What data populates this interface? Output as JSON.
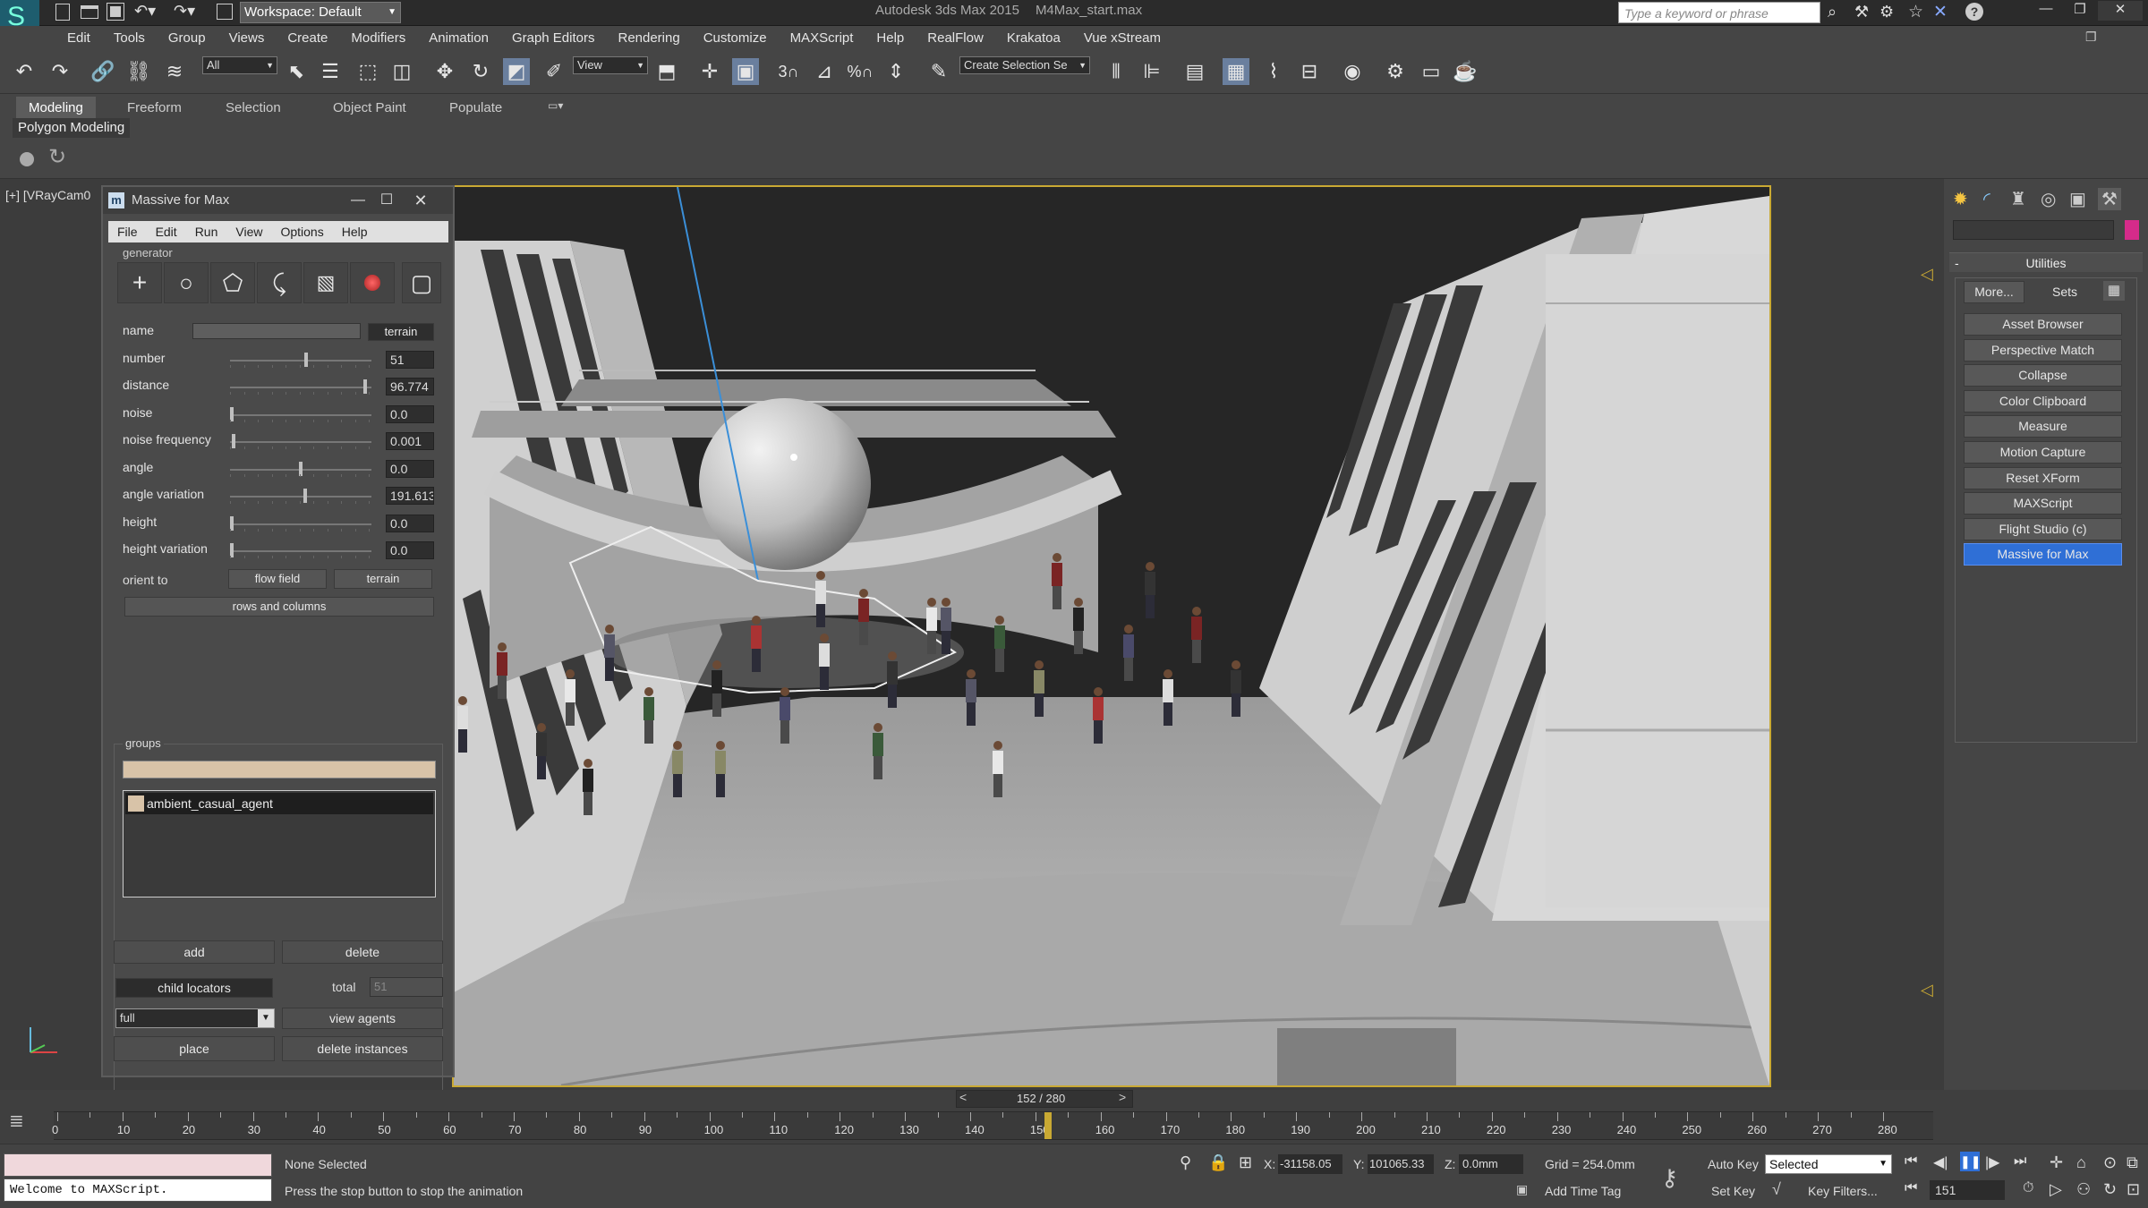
{
  "app": {
    "title": "Autodesk 3ds Max 2015",
    "file": "M4Max_start.max",
    "workspace": "Workspace: Default",
    "search_placeholder": "Type a keyword or phrase"
  },
  "menus": [
    "Edit",
    "Tools",
    "Group",
    "Views",
    "Create",
    "Modifiers",
    "Animation",
    "Graph Editors",
    "Rendering",
    "Customize",
    "MAXScript",
    "Help",
    "RealFlow",
    "Krakatoa",
    "Vue xStream"
  ],
  "toolbar": {
    "filter": "All",
    "ref_coord": "View",
    "selection_set": "Create Selection Se",
    "snap_label": "3"
  },
  "ribbon": {
    "tabs": [
      "Modeling",
      "Freeform",
      "Selection",
      "Object Paint",
      "Populate"
    ],
    "sub": "Polygon Modeling"
  },
  "viewport": {
    "label": "[+] [VRayCam0"
  },
  "massive": {
    "title": "Massive for Max",
    "menus": [
      "File",
      "Edit",
      "Run",
      "View",
      "Options",
      "Help"
    ],
    "generator_label": "generator",
    "params": [
      {
        "label": "name",
        "value": "",
        "level": null
      },
      {
        "label": "number",
        "value": "51",
        "level": 0.54
      },
      {
        "label": "distance",
        "value": "96.774",
        "level": 0.97
      },
      {
        "label": "noise",
        "value": "0.0",
        "level": 0.0
      },
      {
        "label": "noise frequency",
        "value": "0.001",
        "level": 0.01
      },
      {
        "label": "angle",
        "value": "0.0",
        "level": 0.5
      },
      {
        "label": "angle variation",
        "value": "191.613",
        "level": 0.53
      },
      {
        "label": "height",
        "value": "0.0",
        "level": 0.0
      },
      {
        "label": "height variation",
        "value": "0.0",
        "level": 0.0
      }
    ],
    "name_button": "terrain",
    "orient_label": "orient to",
    "orient_options": [
      "flow field",
      "terrain"
    ],
    "rows_columns": "rows and columns",
    "groups_label": "groups",
    "group_items": [
      "ambient_casual_agent"
    ],
    "add": "add",
    "delete": "delete",
    "child_locators": "child locators",
    "total_label": "total",
    "total_value": "51",
    "mode": "full",
    "view_agents": "view agents",
    "place": "place",
    "delete_instances": "delete instances"
  },
  "command_panel": {
    "section": "Utilities",
    "more": "More...",
    "sets": "Sets",
    "utilities": [
      "Asset Browser",
      "Perspective Match",
      "Collapse",
      "Color Clipboard",
      "Measure",
      "Motion Capture",
      "Reset XForm",
      "MAXScript",
      "Flight Studio (c)",
      "Massive for Max"
    ],
    "active_utility": "Massive for Max"
  },
  "timeline": {
    "frame_readout": "152 / 280",
    "ticks": [
      "0",
      "10",
      "20",
      "30",
      "40",
      "50",
      "60",
      "70",
      "80",
      "90",
      "100",
      "110",
      "120",
      "130",
      "140",
      "150",
      "160",
      "170",
      "180",
      "190",
      "200",
      "210",
      "220",
      "230",
      "240",
      "250",
      "260",
      "270",
      "280"
    ],
    "current_frame": 152
  },
  "status": {
    "listener": "Welcome to MAXScript.",
    "selection": "None Selected",
    "prompt": "Press the stop button to stop the animation",
    "x_label": "X:",
    "x": "-31158.05",
    "y_label": "Y:",
    "y": "101065.33",
    "z_label": "Z:",
    "z": "0.0mm",
    "grid": "Grid = 254.0mm",
    "auto_key": "Auto Key",
    "set_key": "Set Key",
    "selected": "Selected",
    "key_filters": "Key Filters...",
    "add_time_tag": "Add Time Tag",
    "frame": "151"
  },
  "colors": {
    "accent_blue": "#2f6fd6",
    "viewport_border": "#c9a933",
    "key_pink": "#d52b8a"
  }
}
